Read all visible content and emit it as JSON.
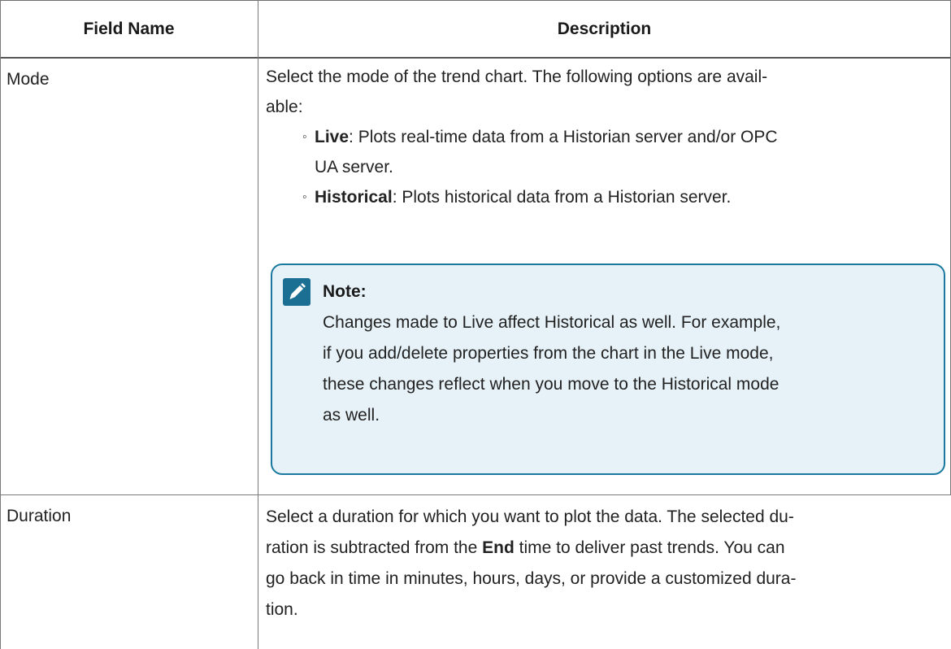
{
  "header": {
    "field_name": "Field Name",
    "description": "Description"
  },
  "rows": [
    {
      "name": "Mode",
      "intro_line1": "Select the mode of the trend chart. The following options are avail-",
      "intro_line2": "able:",
      "options": [
        {
          "term": "Live",
          "text_line1": ": Plots real-time data from a Historian server and/or OPC",
          "text_line2": "UA server."
        },
        {
          "term": "Historical",
          "text_line1": ": Plots historical data from a Historian server."
        }
      ],
      "note": {
        "icon": "pencil-note-icon",
        "title": "Note:",
        "lines": [
          "Changes made to Live affect Historical as well. For example,",
          "if you add/delete properties from the chart in the Live mode,",
          "these changes reflect when you move to the Historical mode",
          "as well."
        ]
      }
    },
    {
      "name": "Duration",
      "text_line1": "Select a duration for which you want to plot the data. The selected du-",
      "text_line2_pre": "ration is subtracted from the ",
      "text_line2_bold": "End",
      "text_line2_post": " time to deliver past trends. You can",
      "text_line3": "go back in time in minutes, hours, days, or provide a customized dura-",
      "text_line4": "tion."
    }
  ],
  "colors": {
    "note_background": "#e6f2f8",
    "note_border": "#1b79a0",
    "note_icon": "#1b6f93"
  }
}
